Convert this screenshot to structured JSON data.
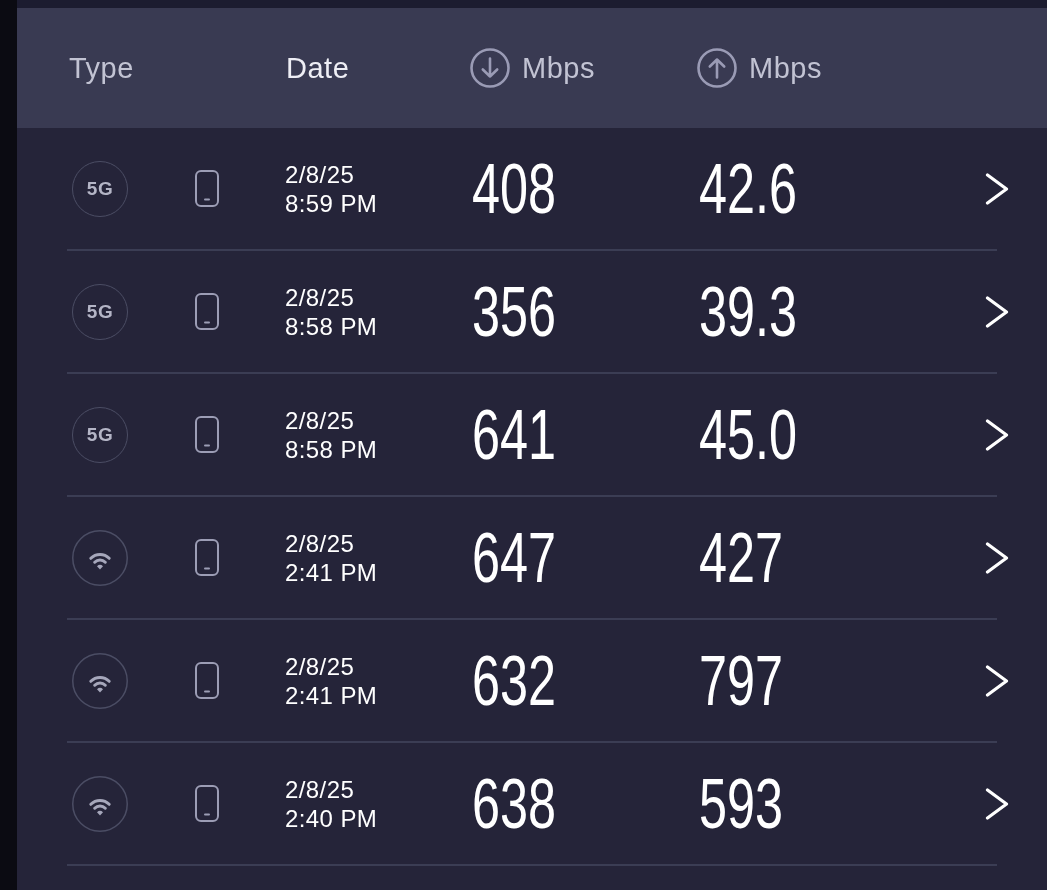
{
  "table": {
    "columns": [
      {
        "kind": "text",
        "label": "Type",
        "selected": false
      },
      {
        "kind": "text",
        "label": "Date",
        "selected": true
      },
      {
        "kind": "download",
        "label": "Mbps",
        "selected": false
      },
      {
        "kind": "upload",
        "label": "Mbps",
        "selected": false
      }
    ],
    "rows": [
      {
        "network": {
          "kind": "cellular",
          "label": "5G"
        },
        "device": {
          "kind": "phone"
        },
        "date": "2/8/25",
        "time": "8:59 PM",
        "download": "408",
        "upload": "42.6"
      },
      {
        "network": {
          "kind": "cellular",
          "label": "5G"
        },
        "device": {
          "kind": "phone"
        },
        "date": "2/8/25",
        "time": "8:58 PM",
        "download": "356",
        "upload": "39.3"
      },
      {
        "network": {
          "kind": "cellular",
          "label": "5G"
        },
        "device": {
          "kind": "phone"
        },
        "date": "2/8/25",
        "time": "8:58 PM",
        "download": "641",
        "upload": "45.0"
      },
      {
        "network": {
          "kind": "wifi"
        },
        "device": {
          "kind": "phone"
        },
        "date": "2/8/25",
        "time": "2:41 PM",
        "download": "647",
        "upload": "427"
      },
      {
        "network": {
          "kind": "wifi"
        },
        "device": {
          "kind": "phone"
        },
        "date": "2/8/25",
        "time": "2:41 PM",
        "download": "632",
        "upload": "797"
      },
      {
        "network": {
          "kind": "wifi"
        },
        "device": {
          "kind": "phone"
        },
        "date": "2/8/25",
        "time": "2:40 PM",
        "download": "638",
        "upload": "593"
      }
    ]
  }
}
